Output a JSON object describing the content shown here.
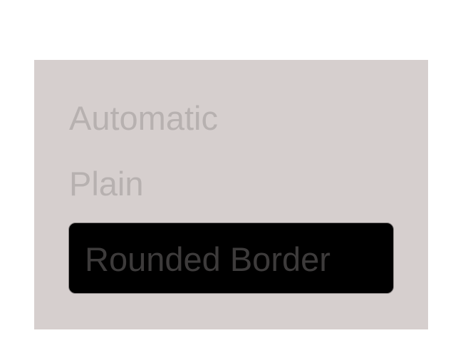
{
  "options": {
    "automatic": "Automatic",
    "plain": "Plain"
  },
  "textfield": {
    "label": "Rounded Border"
  },
  "colors": {
    "panel_background": "#d6cfce",
    "option_text": "#b7b1b0",
    "field_background": "#000000",
    "field_text": "#3d3b3b"
  }
}
